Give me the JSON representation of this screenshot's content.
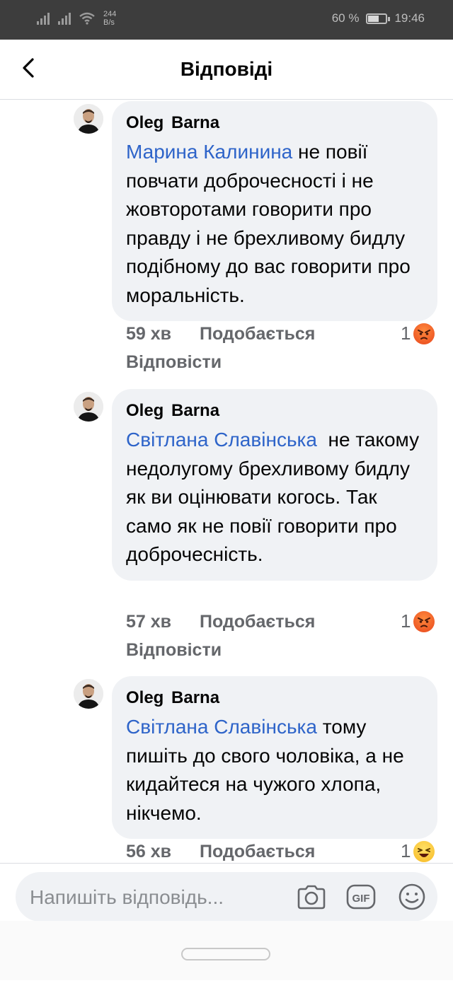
{
  "status_bar": {
    "speed_value": "244",
    "speed_unit": "B/s",
    "battery": "60 %",
    "battery_level": 0.6,
    "time": "19:46"
  },
  "header": {
    "title": "Відповіді"
  },
  "comments": [
    {
      "author": "Oleg  Barna",
      "mention": "Марина Калинина",
      "text": " не повії повчати доброчесності і не жовторотами говорити про правду і не брехливому бидлу подібному до вас говорити про моральність.",
      "time": "59 хв",
      "like": "Подобається",
      "reply": "Відповісти",
      "reaction_count": "1",
      "reaction": "angry-emoji"
    },
    {
      "author": "Oleg  Barna",
      "mention": "Світлана Славінська",
      "text": "  не такому недолугому брехливому бидлу як ви оцінювати когось. Так само як не повії говорити про доброчесність.",
      "time": "57 хв",
      "like": "Подобається",
      "reply": "Відповісти",
      "reaction_count": "1",
      "reaction": "angry-emoji"
    },
    {
      "author": "Oleg  Barna",
      "mention": "Світлана Славінська",
      "text": " тому пишіть до свого чоловіка, а не кидайтеся на чужого хлопа, нікчемо.",
      "time": "56 хв",
      "like": "Подобається",
      "reaction_count": "1",
      "reaction": "haha-emoji"
    }
  ],
  "composer": {
    "placeholder": "Напишіть відповідь...",
    "gif_label": "GIF"
  },
  "colors": {
    "mention": "#2e64c9",
    "bubble": "#f0f2f5",
    "meta": "#65676b"
  }
}
